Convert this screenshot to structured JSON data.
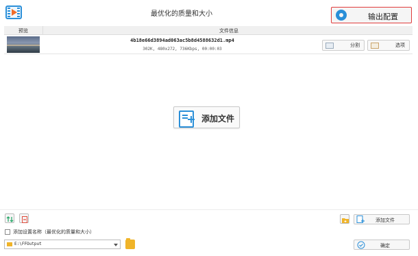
{
  "window": {
    "title": "最优化的质量和大小"
  },
  "toolbar": {
    "output_config_label": "输出配置"
  },
  "table": {
    "headers": [
      "预览",
      "文件信息"
    ],
    "rows": [
      {
        "filename": "4b18e66d3894ad063ac5b8d4588632d1.mp4",
        "info": "302K, 480x272, 736Kbps, 00:00:03",
        "split_label": "分割",
        "options_label": "选项"
      }
    ]
  },
  "center": {
    "add_file_label": "添加文件"
  },
  "bottom": {
    "add_file_label": "添加文件",
    "checkbox_label": "添加设置名称（最优化的质量和大小）",
    "checkbox_checked": false,
    "output_path": "E:\\FFOutput",
    "ok_label": "确定"
  },
  "colors": {
    "accent": "#2a8fd8",
    "highlight_border": "#e03a3a",
    "folder": "#f0b429"
  }
}
